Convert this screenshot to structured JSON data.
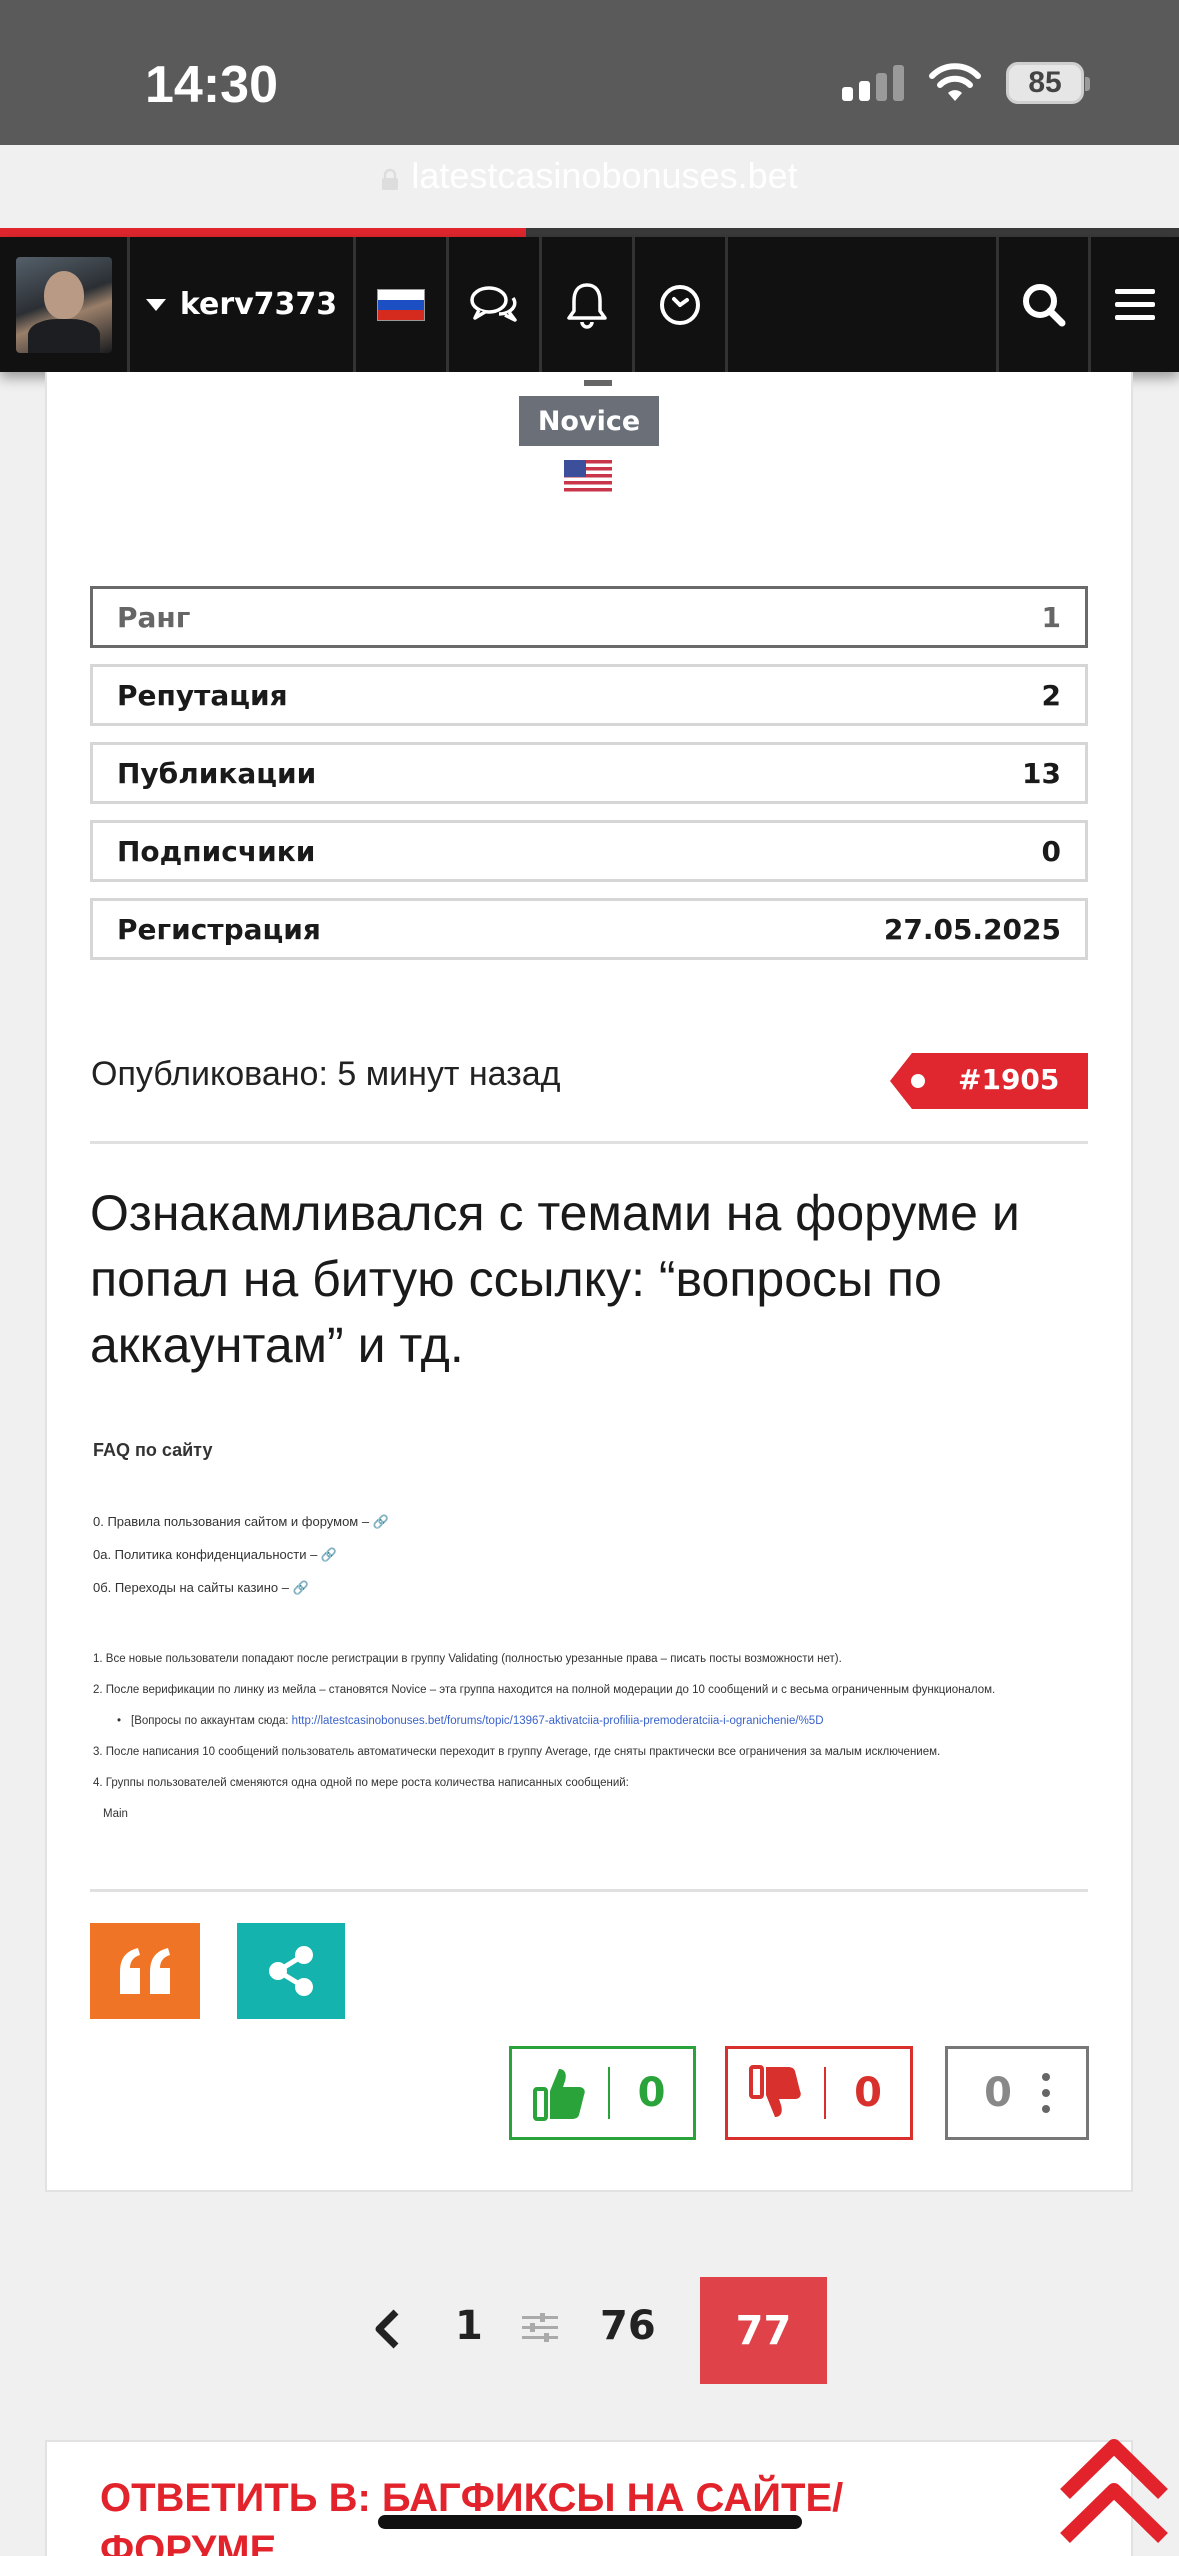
{
  "status": {
    "time": "14:30",
    "battery": "85"
  },
  "browser": {
    "url": "latestcasinobonuses.bet",
    "load_progress_percent": 44.6
  },
  "nav": {
    "username": "kerv7373"
  },
  "profile": {
    "rank_badge": "Novice",
    "stats": [
      {
        "label": "Ранг",
        "value": "1"
      },
      {
        "label": "Репутация",
        "value": "2"
      },
      {
        "label": "Публикации",
        "value": "13"
      },
      {
        "label": "Подписчики",
        "value": "0"
      },
      {
        "label": "Регистрация",
        "value": "27.05.2025"
      }
    ]
  },
  "post": {
    "published": "Опубликовано: 5 минут назад",
    "number": "#1905",
    "title": "Ознакамливался с темами на форуме и попал на битую ссылку: “вопросы по аккаунтам” и тд.",
    "faq": {
      "title": "FAQ по сайту",
      "links": [
        "0. Правила пользования сайтом и форумом – 🔗",
        "0а. Политика конфиденциальности – 🔗",
        "0б. Переходы на сайты казино – 🔗"
      ],
      "items": [
        "1. Все новые пользователи попадают после регистрации в группу Validating (полностью урезанные права – писать посты возможности нет).",
        "2. После верификации по линку из мейла – становятся Novice – эта группа находится на полной модерации до 10 сообщений и с весьма ограниченным функционалом."
      ],
      "bullet_prefix": "[Вопросы по аккаунтам сюда: ",
      "bullet_link": "http://latestcasinobonuses.bet/forums/topic/13967-aktivatciia-profiliia-premoderatciia-i-ogranichenie/%5D",
      "items2": [
        "3. После написания 10 сообщений пользователь автоматически переходит в группу Average, где сняты практически все ограничения за малым исключением.",
        "4. Группы пользователей сменяются одна одной по мере роста количества написанных сообщений:"
      ],
      "footer": "Main"
    },
    "votes": {
      "up": "0",
      "down": "0",
      "total": "0"
    }
  },
  "pagination": {
    "first": "1",
    "prev_last": "76",
    "current": "77"
  },
  "reply": {
    "title": "Ответить в: Багфиксы на сайте/форуме"
  },
  "colors": {
    "accent": "#e0262e",
    "quote": "#f07425",
    "share": "#15b3ad",
    "up": "#2aa43a",
    "down": "#d8312d"
  }
}
